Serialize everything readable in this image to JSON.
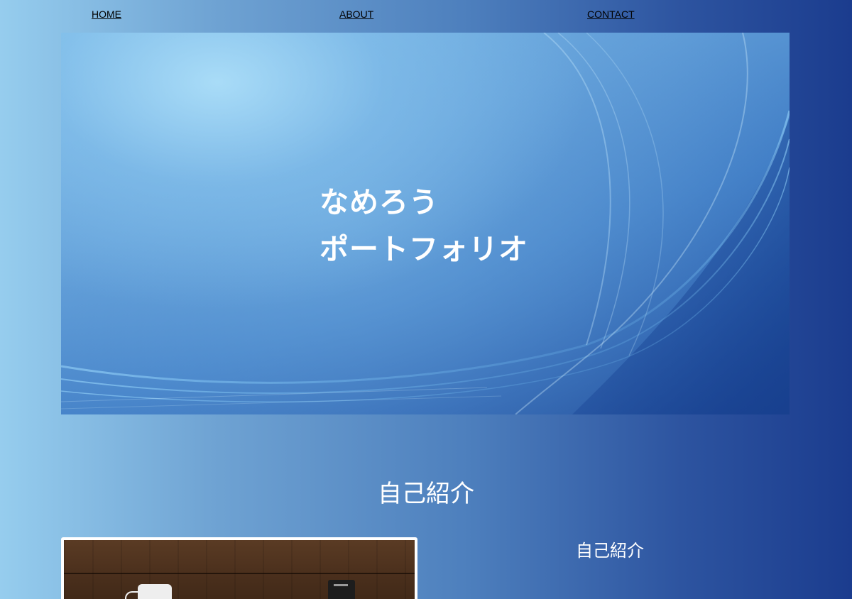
{
  "nav": {
    "home_label": "HOME",
    "about_label": "ABOUT",
    "contact_label": "CONTACT"
  },
  "hero": {
    "title_line1": "なめろう",
    "title_line2": "ポートフォリオ"
  },
  "about": {
    "section_title": "自己紹介",
    "subtitle": "自己紹介"
  },
  "colors": {
    "background_left": "#96cdee",
    "background_right": "#1b3c8e",
    "hero_text": "#ffffff",
    "nav_link": "#000000"
  }
}
